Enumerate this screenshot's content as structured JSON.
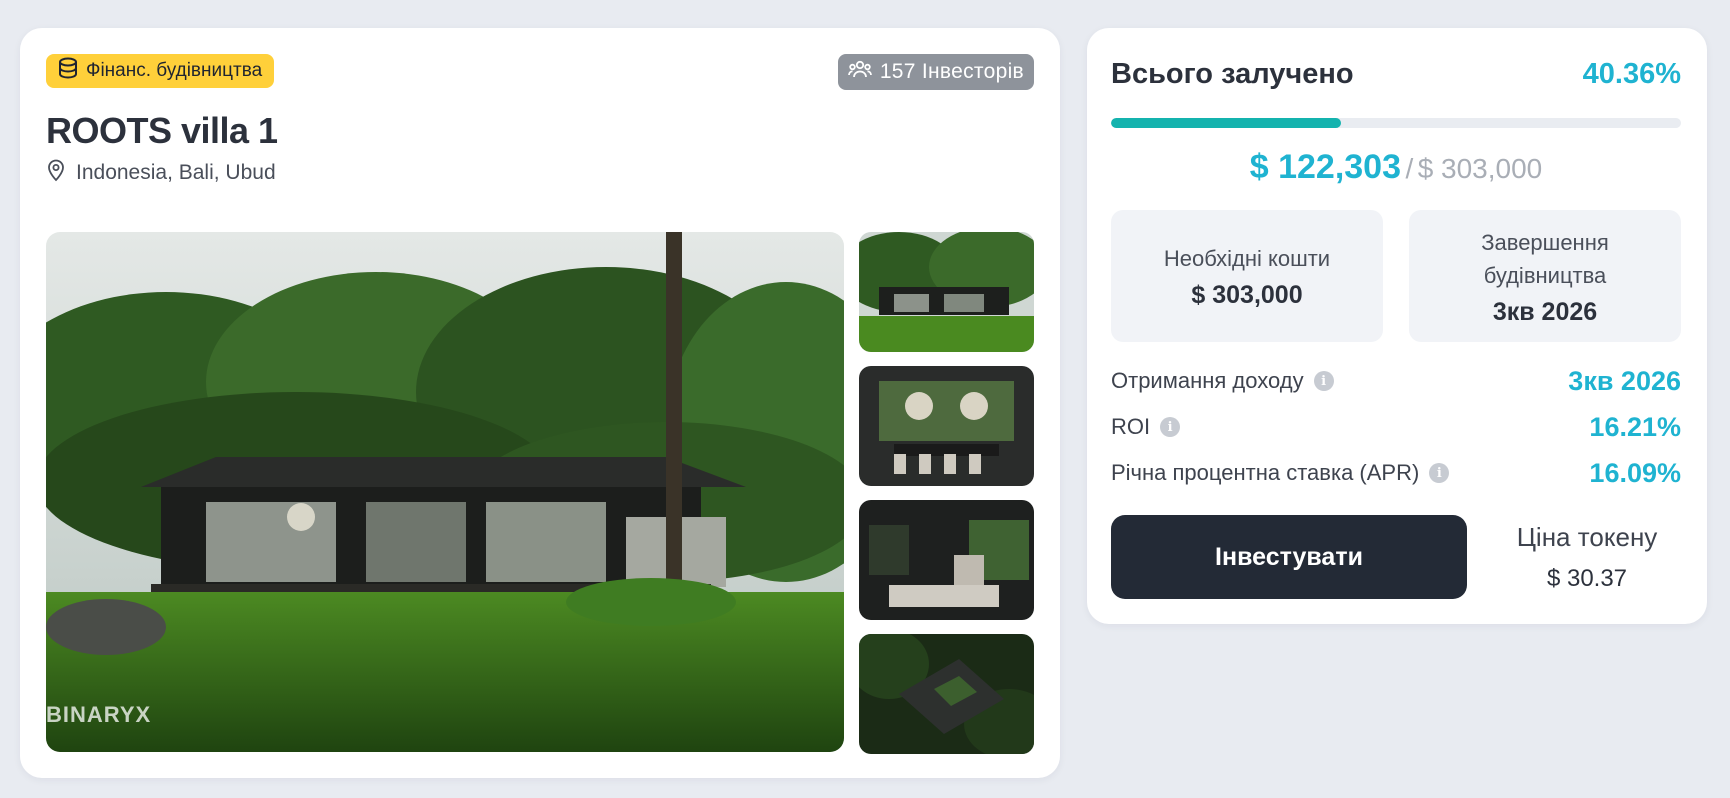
{
  "listing": {
    "category_badge": "Фінанс. будівництва",
    "category_icon": "database-coins-icon",
    "investors_badge": "157 Інвесторів",
    "investors_icon": "users-icon",
    "title": "ROOTS villa 1",
    "location": "Indonesia, Bali, Ubud",
    "location_icon": "map-pin-icon",
    "watermark": "BINARYX",
    "thumbnails": [
      "exterior-thumb",
      "dining-room-thumb",
      "living-room-thumb",
      "aerial-view-thumb"
    ]
  },
  "funding": {
    "title": "Всього залучено",
    "percent_label": "40.36%",
    "progress_fraction": 0.4036,
    "raised": "$ 122,303",
    "separator": "/",
    "goal": "$ 303,000",
    "required_label": "Необхідні кошти",
    "required_value": "$ 303,000",
    "completion_label": "Завершення будівництва",
    "completion_value": "3кв 2026"
  },
  "metrics": [
    {
      "label": "Отримання доходу",
      "value": "3кв 2026"
    },
    {
      "label": "ROI",
      "value": "16.21%"
    },
    {
      "label": "Річна процентна ставка (APR)",
      "value": "16.09%"
    }
  ],
  "actions": {
    "invest_label": "Інвестувати",
    "token_price_label": "Ціна токену",
    "token_price_value": "$ 30.37"
  },
  "colors": {
    "accent": "#1fb3d1",
    "progress": "#14b3ae",
    "badge_yellow": "#ffd03a",
    "button_dark": "#232a36"
  }
}
